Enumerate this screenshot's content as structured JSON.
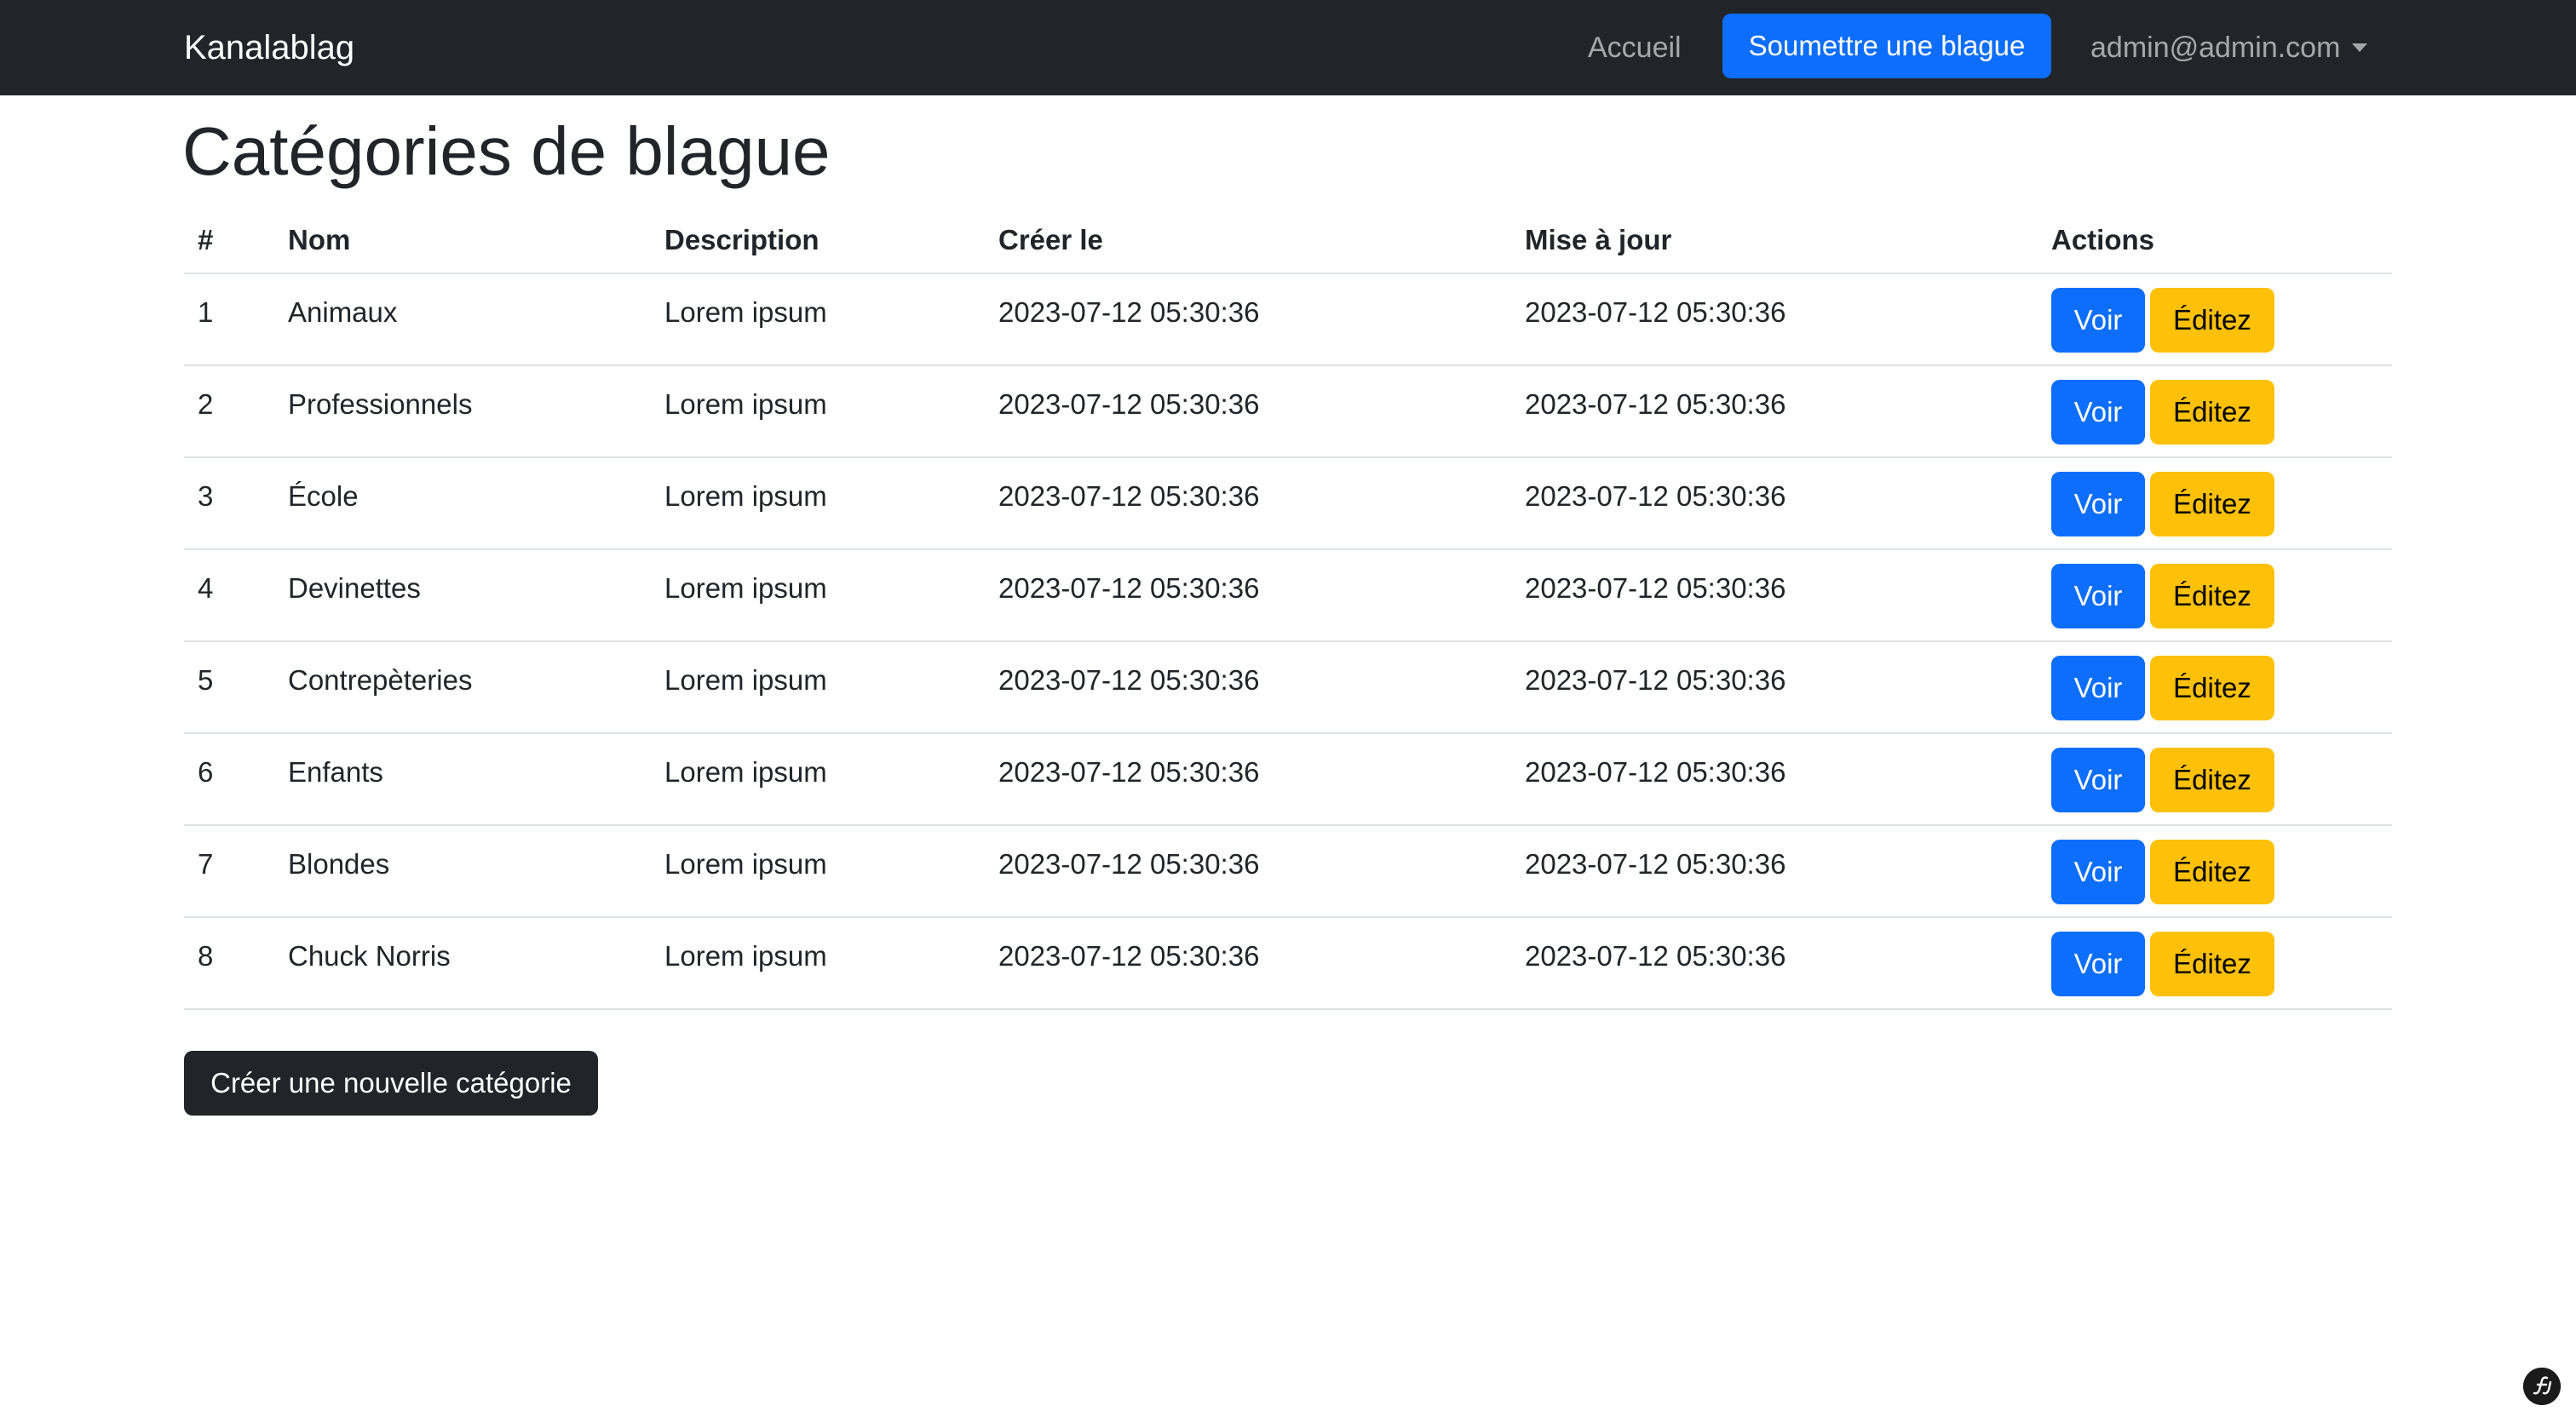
{
  "navbar": {
    "brand": "Kanalablag",
    "home_label": "Accueil",
    "submit_label": "Soumettre une blague",
    "user_label": "admin@admin.com"
  },
  "page": {
    "title": "Catégories de blague"
  },
  "table": {
    "headers": [
      "#",
      "Nom",
      "Description",
      "Créer le",
      "Mise à jour",
      "Actions"
    ],
    "rows": [
      {
        "id": "1",
        "name": "Animaux",
        "description": "Lorem ipsum",
        "created": "2023-07-12 05:30:36",
        "updated": "2023-07-12 05:30:36"
      },
      {
        "id": "2",
        "name": "Professionnels",
        "description": "Lorem ipsum",
        "created": "2023-07-12 05:30:36",
        "updated": "2023-07-12 05:30:36"
      },
      {
        "id": "3",
        "name": "École",
        "description": "Lorem ipsum",
        "created": "2023-07-12 05:30:36",
        "updated": "2023-07-12 05:30:36"
      },
      {
        "id": "4",
        "name": "Devinettes",
        "description": "Lorem ipsum",
        "created": "2023-07-12 05:30:36",
        "updated": "2023-07-12 05:30:36"
      },
      {
        "id": "5",
        "name": "Contrepèteries",
        "description": "Lorem ipsum",
        "created": "2023-07-12 05:30:36",
        "updated": "2023-07-12 05:30:36"
      },
      {
        "id": "6",
        "name": "Enfants",
        "description": "Lorem ipsum",
        "created": "2023-07-12 05:30:36",
        "updated": "2023-07-12 05:30:36"
      },
      {
        "id": "7",
        "name": "Blondes",
        "description": "Lorem ipsum",
        "created": "2023-07-12 05:30:36",
        "updated": "2023-07-12 05:30:36"
      },
      {
        "id": "8",
        "name": "Chuck Norris",
        "description": "Lorem ipsum",
        "created": "2023-07-12 05:30:36",
        "updated": "2023-07-12 05:30:36"
      }
    ],
    "view_label": "Voir",
    "edit_label": "Éditez"
  },
  "create_button_label": "Créer une nouvelle catégorie",
  "icons": {
    "toolbar_badge": "symfony-toolbar-icon",
    "dropdown": "chevron-down-icon"
  },
  "colors": {
    "navbar_bg": "#212529",
    "primary": "#0d6efd",
    "warning": "#ffc107",
    "dark": "#212529"
  }
}
